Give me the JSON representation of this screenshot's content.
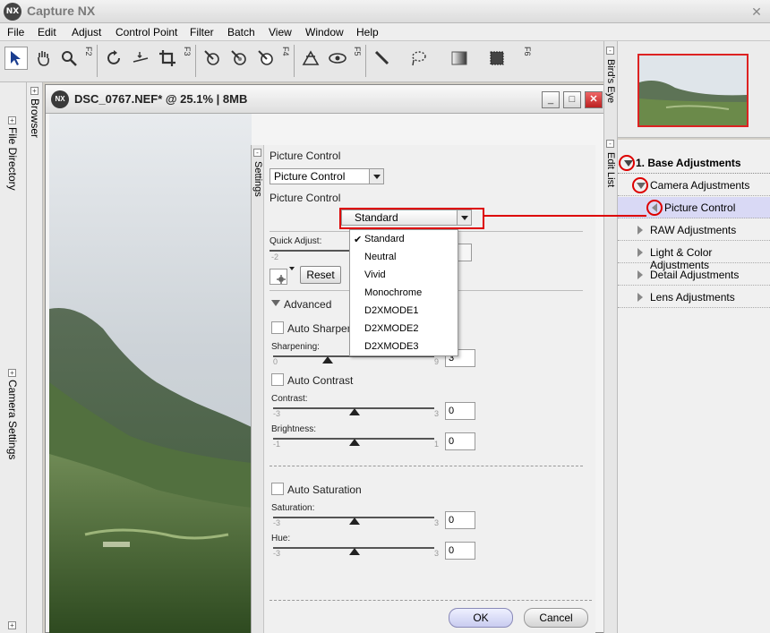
{
  "app": {
    "title": "Capture NX",
    "logo": "NX"
  },
  "menu": [
    "File",
    "Edit",
    "Adjust",
    "Control Point",
    "Filter",
    "Batch",
    "View",
    "Window",
    "Help"
  ],
  "toolbar": {
    "f2": "F2",
    "f3": "F3",
    "f4": "F4",
    "f5": "F5",
    "f6": "F6"
  },
  "left_tabs": {
    "file_directory": "File Directory",
    "camera_settings": "Camera Settings",
    "browser": "Browser"
  },
  "image_window": {
    "title": "DSC_0767.NEF* @ 25.1% | 8MB",
    "logo": "NX"
  },
  "settings": {
    "tab_label": "Settings",
    "heading": "Picture Control",
    "type_select": "Picture Control",
    "control_label": "Picture Control",
    "control_value": "Standard",
    "quick_adjust_label": "Quick Adjust:",
    "quick_adjust_min": "-2",
    "reset_label": "Reset",
    "advanced_label": "Advanced",
    "auto_sharpen": "Auto Sharpen",
    "sharpening_label": "Sharpening:",
    "sharpening_min": "0",
    "sharpening_max": "9",
    "sharpening_value": "3",
    "auto_contrast": "Auto Contrast",
    "contrast_label": "Contrast:",
    "contrast_min": "-3",
    "contrast_max": "3",
    "contrast_value": "0",
    "brightness_label": "Brightness:",
    "brightness_min": "-1",
    "brightness_max": "1",
    "brightness_value": "0",
    "auto_saturation": "Auto Saturation",
    "saturation_label": "Saturation:",
    "saturation_min": "-3",
    "saturation_max": "3",
    "saturation_value": "0",
    "hue_label": "Hue:",
    "hue_min": "-3",
    "hue_max": "3",
    "hue_value": "0",
    "ok_label": "OK",
    "cancel_label": "Cancel"
  },
  "dropdown": {
    "check": "✔",
    "options": [
      "Standard",
      "Neutral",
      "Vivid",
      "Monochrome",
      "D2XMODE1",
      "D2XMODE2",
      "D2XMODE3"
    ],
    "selected": "Standard"
  },
  "right_tabs": {
    "birds_eye": "Bird's Eye",
    "edit_list": "Edit List"
  },
  "edit_list": {
    "base": "1. Base Adjustments",
    "camera": "Camera Adjustments",
    "picture_control": "Picture Control",
    "raw": "RAW Adjustments",
    "light": "Light & Color Adjustments",
    "detail": "Detail Adjustments",
    "lens": "Lens Adjustments"
  },
  "colors": {
    "annotation": "#dd0000",
    "selection": "#d9d9f5",
    "ok_button": "#c9ccf0"
  }
}
